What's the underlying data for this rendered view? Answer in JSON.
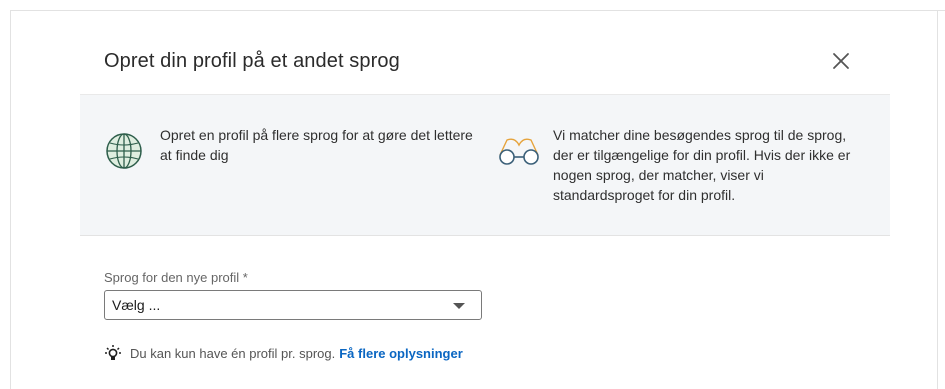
{
  "dialog": {
    "title": "Opret din profil på et andet sprog",
    "close_icon": "close-icon"
  },
  "info": {
    "left": {
      "icon": "globe-icon",
      "text": "Opret en profil på flere sprog for at gøre det lettere at finde dig"
    },
    "right": {
      "icon": "glasses-icon",
      "text": "Vi matcher dine besøgendes sprog til de sprog, der er tilgængelige for din profil. Hvis der ikke er nogen sprog, der matcher, viser vi standardsproget for din profil."
    }
  },
  "form": {
    "language_label": "Sprog for den nye profil *",
    "language_select_value": "Vælg ...",
    "dropdown_icon": "chevron-down-icon"
  },
  "tip": {
    "icon": "lightbulb-icon",
    "text": "Du kan kun have én profil pr. sprog.",
    "link_label": "Få flere oplysninger"
  },
  "colors": {
    "panel_background": "#f4f6f8",
    "link": "#0a66c2",
    "globe_fill": "#dfeee0",
    "globe_stroke": "#2e5e4b",
    "glasses_frame": "#e6a33b",
    "glasses_lens": "#3a5f78"
  }
}
